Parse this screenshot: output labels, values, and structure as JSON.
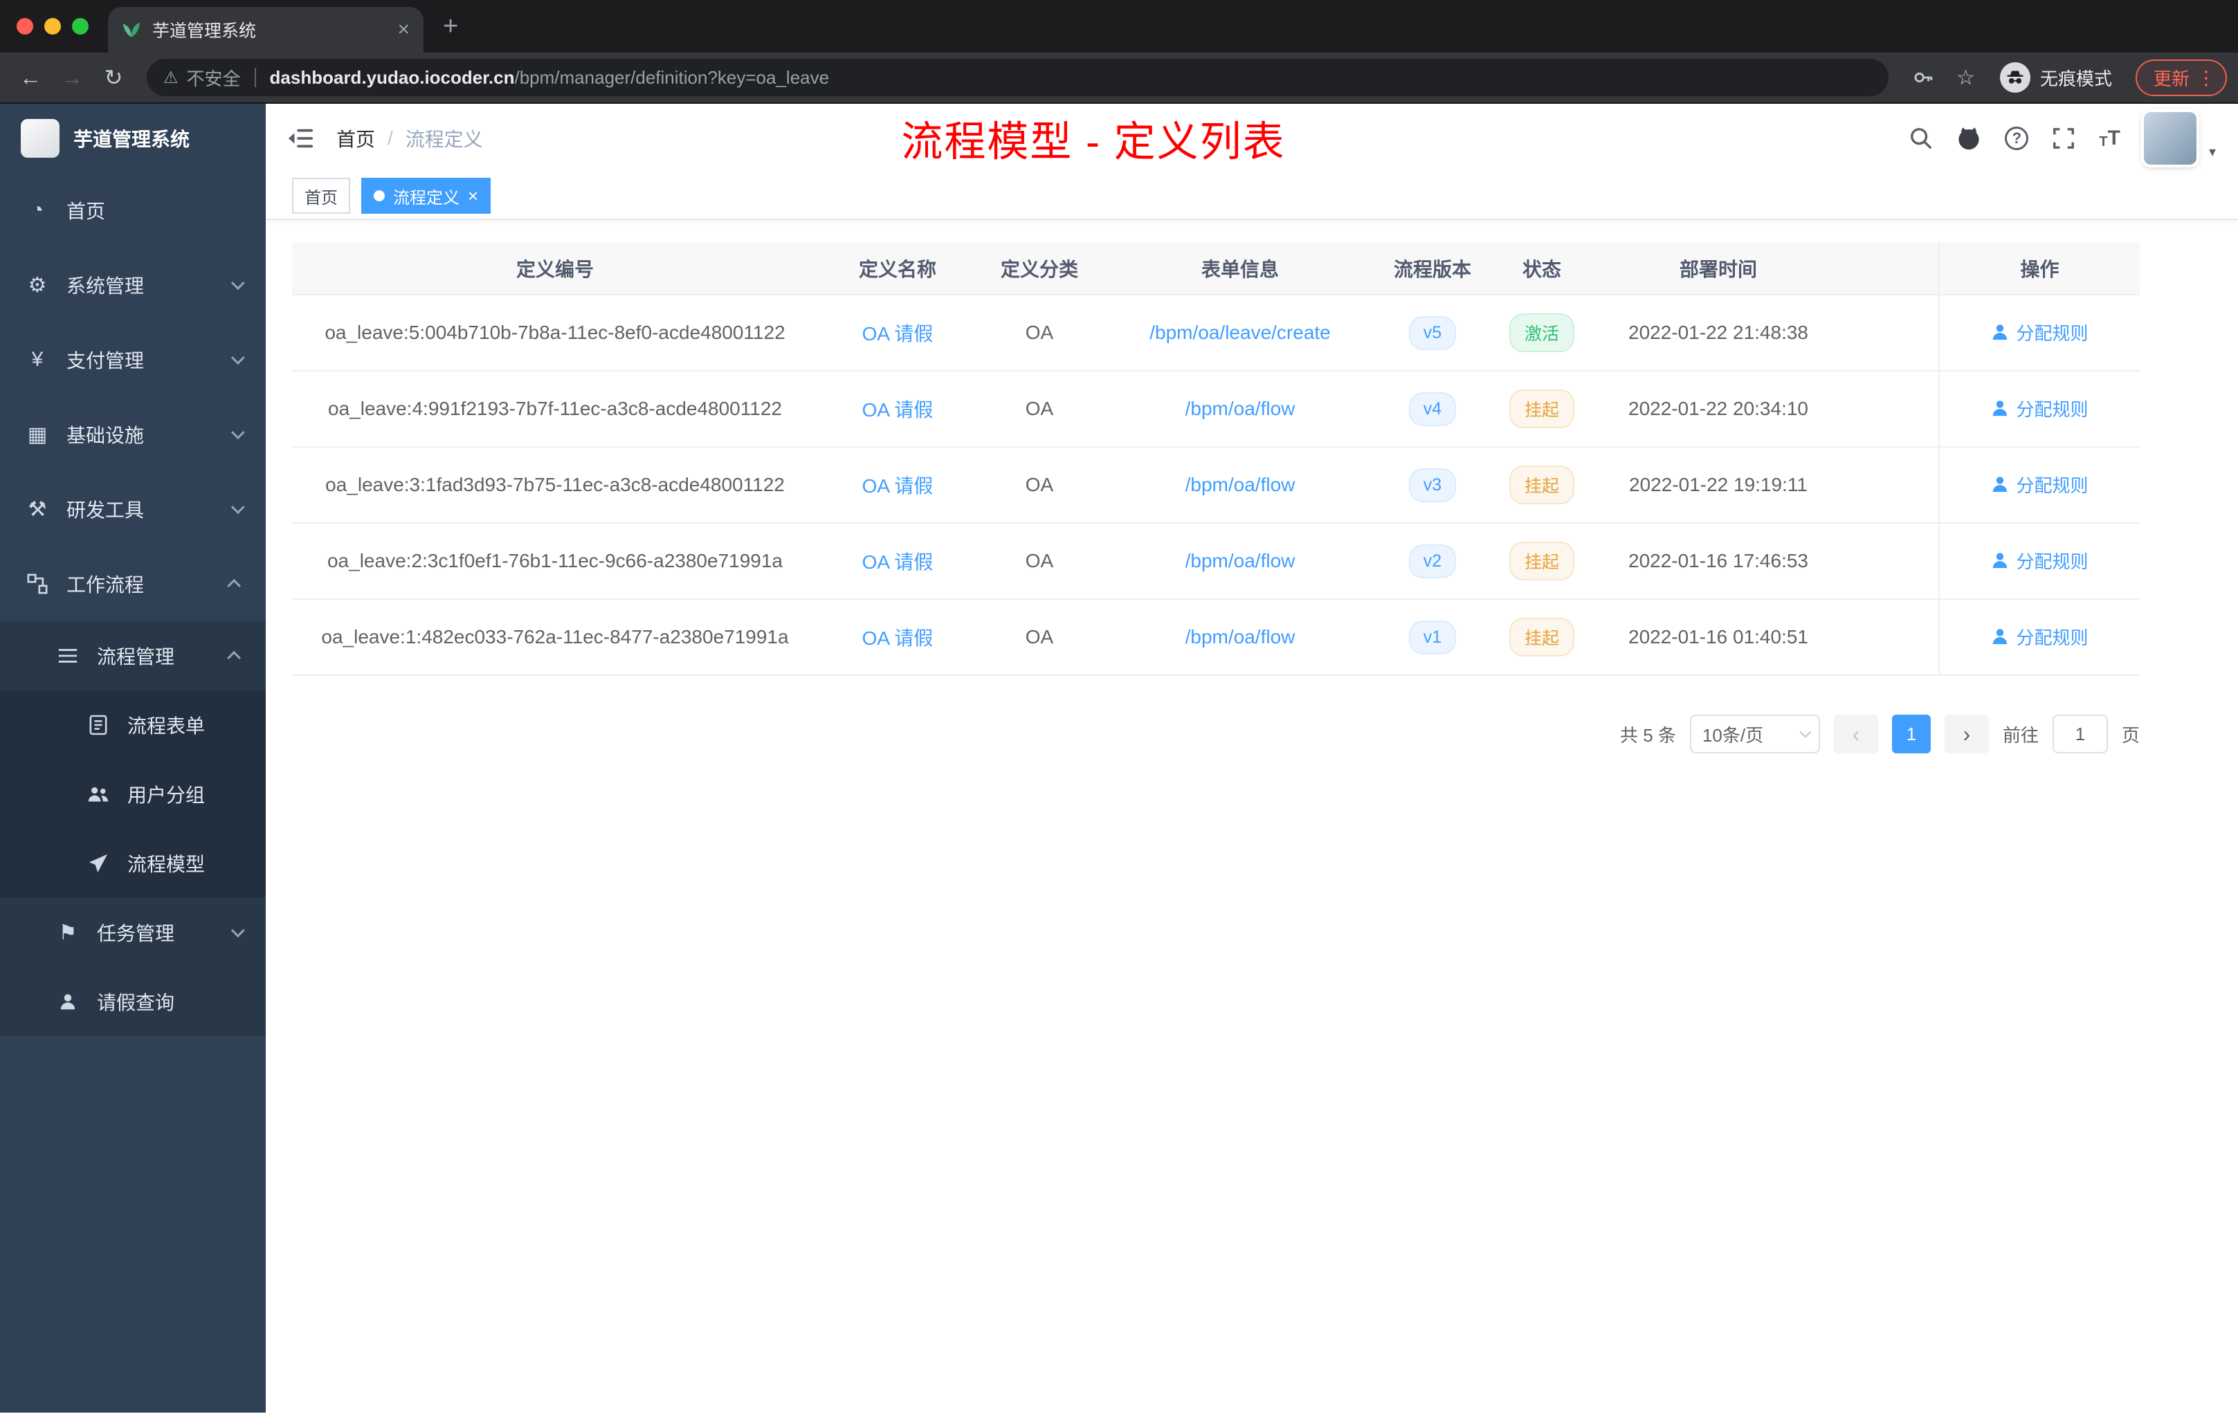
{
  "browser": {
    "tab": {
      "title": "芋道管理系统"
    },
    "address": {
      "security": "不安全",
      "domain": "dashboard.yudao.iocoder.cn",
      "path": "/bpm/manager/definition?key=oa_leave",
      "incognito": "无痕模式",
      "update": "更新"
    }
  },
  "glyphs": {
    "close": "×",
    "plus": "+",
    "kebab": "⋮",
    "caret_down": "▾",
    "slash": "/",
    "warning": "⚠",
    "back": "←",
    "forward": "→",
    "reload": "↻",
    "star": "☆",
    "question": "?",
    "prev": "‹",
    "next": "›",
    "dashboard": "◔",
    "gear": "⚙",
    "yen": "¥",
    "infra": "▦",
    "tools": "⚒",
    "task": "⚑"
  },
  "sidebar": {
    "title": "芋道管理系统",
    "items": [
      {
        "label": "首页"
      },
      {
        "label": "系统管理"
      },
      {
        "label": "支付管理"
      },
      {
        "label": "基础设施"
      },
      {
        "label": "研发工具"
      },
      {
        "label": "工作流程"
      },
      {
        "label": "流程管理"
      },
      {
        "label": "流程表单"
      },
      {
        "label": "用户分组"
      },
      {
        "label": "流程模型"
      },
      {
        "label": "任务管理"
      },
      {
        "label": "请假查询"
      }
    ]
  },
  "header": {
    "breadcrumb": {
      "root": "首页",
      "current": "流程定义"
    },
    "title": "流程模型 - 定义列表"
  },
  "tags": {
    "home": "首页",
    "active": "流程定义"
  },
  "table": {
    "columns": [
      "定义编号",
      "定义名称",
      "定义分类",
      "表单信息",
      "流程版本",
      "状态",
      "部署时间",
      "操作"
    ],
    "rows": [
      {
        "id": "oa_leave:5:004b710b-7b8a-11ec-8ef0-acde48001122",
        "name": "OA 请假",
        "category": "OA",
        "form": "/bpm/oa/leave/create",
        "version": "v5",
        "status": "激活",
        "time": "2022-01-22 21:48:38",
        "action": "分配规则"
      },
      {
        "id": "oa_leave:4:991f2193-7b7f-11ec-a3c8-acde48001122",
        "name": "OA 请假",
        "category": "OA",
        "form": "/bpm/oa/flow",
        "version": "v4",
        "status": "挂起",
        "time": "2022-01-22 20:34:10",
        "action": "分配规则"
      },
      {
        "id": "oa_leave:3:1fad3d93-7b75-11ec-a3c8-acde48001122",
        "name": "OA 请假",
        "category": "OA",
        "form": "/bpm/oa/flow",
        "version": "v3",
        "status": "挂起",
        "time": "2022-01-22 19:19:11",
        "action": "分配规则"
      },
      {
        "id": "oa_leave:2:3c1f0ef1-76b1-11ec-9c66-a2380e71991a",
        "name": "OA 请假",
        "category": "OA",
        "form": "/bpm/oa/flow",
        "version": "v2",
        "status": "挂起",
        "time": "2022-01-16 17:46:53",
        "action": "分配规则"
      },
      {
        "id": "oa_leave:1:482ec033-762a-11ec-8477-a2380e71991a",
        "name": "OA 请假",
        "category": "OA",
        "form": "/bpm/oa/flow",
        "version": "v1",
        "status": "挂起",
        "time": "2022-01-16 01:40:51",
        "action": "分配规则"
      }
    ]
  },
  "pagination": {
    "total_label": "共 5 条",
    "page_size_label": "10条/页",
    "page": "1",
    "goto_label": "前往",
    "page_unit_label": "页",
    "goto_value": "1"
  }
}
